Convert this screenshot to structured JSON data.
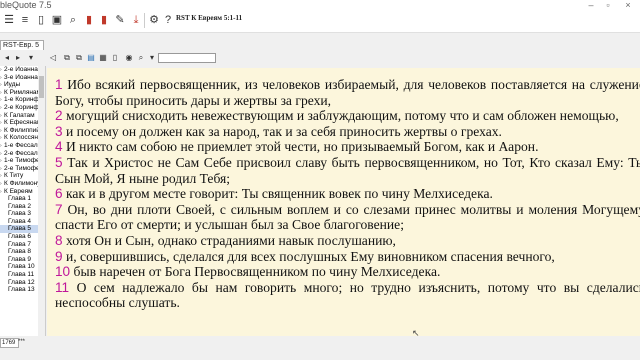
{
  "window": {
    "title": "bleQuote 7.5"
  },
  "toolbar": {
    "reference": "RST К Евреям 5:1-11"
  },
  "tabs": [
    {
      "label": "RST-Евр. 5"
    }
  ],
  "sidebar": {
    "books": [
      "2-е Иоанна",
      "3-е Иоанна",
      "Иуды",
      "К Римлянам",
      "1-е Коринф",
      "2-е Коринф",
      "К Галатам",
      "К Ефесянам",
      "К Филиппий",
      "К Колоссяне",
      "1-е Фессало",
      "2-е Фессало",
      "1-е Тимофе",
      "2-е Тимофе",
      "К Титу",
      "К Филимону",
      "К Евреям"
    ],
    "chapters": [
      "Глава 1",
      "Глава 2",
      "Глава 3",
      "Глава 4",
      "Глава 5",
      "Глава 6",
      "Глава 7",
      "Глава 8",
      "Глава 9",
      "Глава 10",
      "Глава 11",
      "Глава 12",
      "Глава 13"
    ],
    "selected_chapter": "Глава 5"
  },
  "verses": [
    {
      "num": "1",
      "text": "Ибо всякий первосвященник, из человеков избираемый, для человеков поставляется на служение Богу, чтобы приносить дары и жертвы за грехи,"
    },
    {
      "num": "2",
      "text": "могущий снисходить невежествующим и заблуждающим, потому что и сам обложен немощью,"
    },
    {
      "num": "3",
      "text": "и посему он должен как за народ, так и за себя приносить жертвы о грехах."
    },
    {
      "num": "4",
      "text": "И никто сам собою не приемлет этой чести, но призываемый Богом, как и Аарон."
    },
    {
      "num": "5",
      "text": "Так и Христос не Сам Себе присвоил славу быть первосвященником, но Тот, Кто сказал Ему: Ты Сын Мой, Я ныне родил Тебя;"
    },
    {
      "num": "6",
      "text": "как и в другом месте говорит: Ты священник вовек по чину Мелхиседека."
    },
    {
      "num": "7",
      "text": "Он, во дни плоти Своей, с сильным воплем и со слезами принес молитвы и моления Могущему спасти Его от смерти; и услышан был за Свое благоговение;"
    },
    {
      "num": "8",
      "text": "хотя Он и Сын, однако страданиями навык послушанию,"
    },
    {
      "num": "9",
      "text": "и, совершившись, сделался для всех послушных Ему виновником спасения вечного,"
    },
    {
      "num": "10",
      "text": "быв наречен от Бога Первосвященником по чину Мелхиседека."
    },
    {
      "num": "11",
      "text": "О сем надлежало бы нам говорить много; но трудно изъяснить, потому что вы сделались неспособны слушать."
    }
  ],
  "status": {
    "left": "1769",
    "right": "***"
  }
}
